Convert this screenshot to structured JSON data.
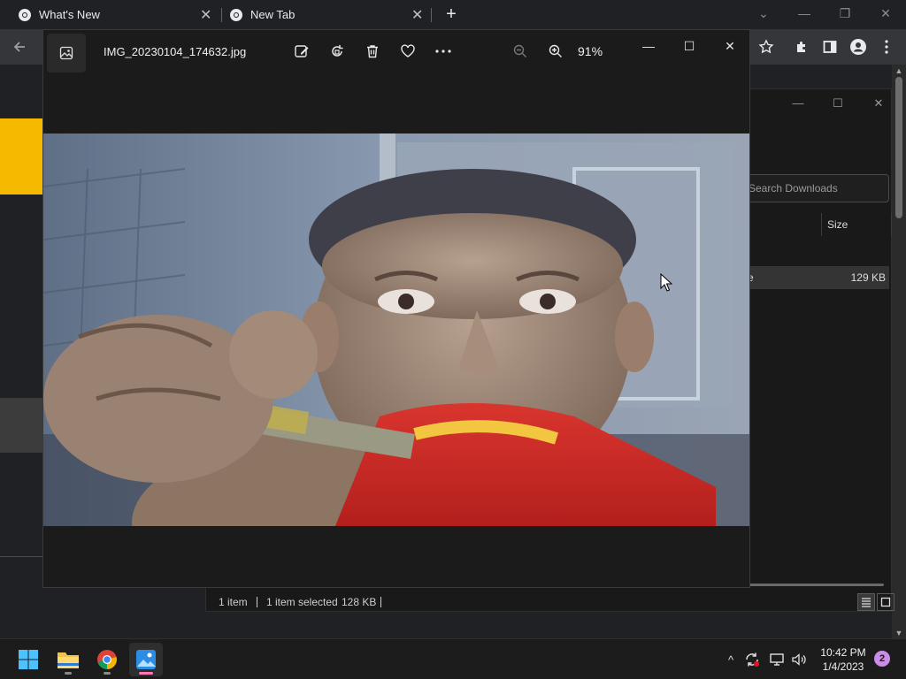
{
  "browser": {
    "tabs": [
      {
        "title": "What's New",
        "close": "✕"
      },
      {
        "title": "New Tab",
        "close": "✕"
      }
    ],
    "new_tab": "+",
    "controls": {
      "dropdown": "⌄",
      "minimize": "—",
      "restore": "❐",
      "close": "✕"
    }
  },
  "explorer": {
    "search_placeholder": "Search Downloads",
    "column_size": "Size",
    "row": {
      "name_fragment": "e",
      "size": "129 KB"
    },
    "status": {
      "items": "1 item",
      "selected": "1 item selected",
      "selected_size": "128 KB"
    },
    "controls": {
      "minimize": "—",
      "maximize": "☐",
      "close": "✕"
    }
  },
  "photos": {
    "filename": "IMG_20230104_174632.jpg",
    "zoom_level": "91%",
    "toolbar": [
      "edit-image",
      "rotate",
      "delete",
      "favorite",
      "more"
    ],
    "controls": {
      "minimize": "—",
      "maximize": "☐",
      "close": "✕"
    }
  },
  "taskbar": {
    "apps": [
      "start",
      "file-explorer",
      "chrome",
      "photos"
    ],
    "clock_time": "10:42 PM",
    "clock_date": "1/4/2023",
    "notification_count": "2",
    "tray": {
      "chevron": "^"
    }
  },
  "colors": {
    "chrome_bg": "#202124",
    "chrome_toolbar": "#35363a",
    "photos_bg": "#1b1b1b",
    "explorer_bg": "#191919",
    "taskbar_bg": "#1c1c1c",
    "photos_accent": "#ff78b4",
    "notification": "#c98de6"
  }
}
